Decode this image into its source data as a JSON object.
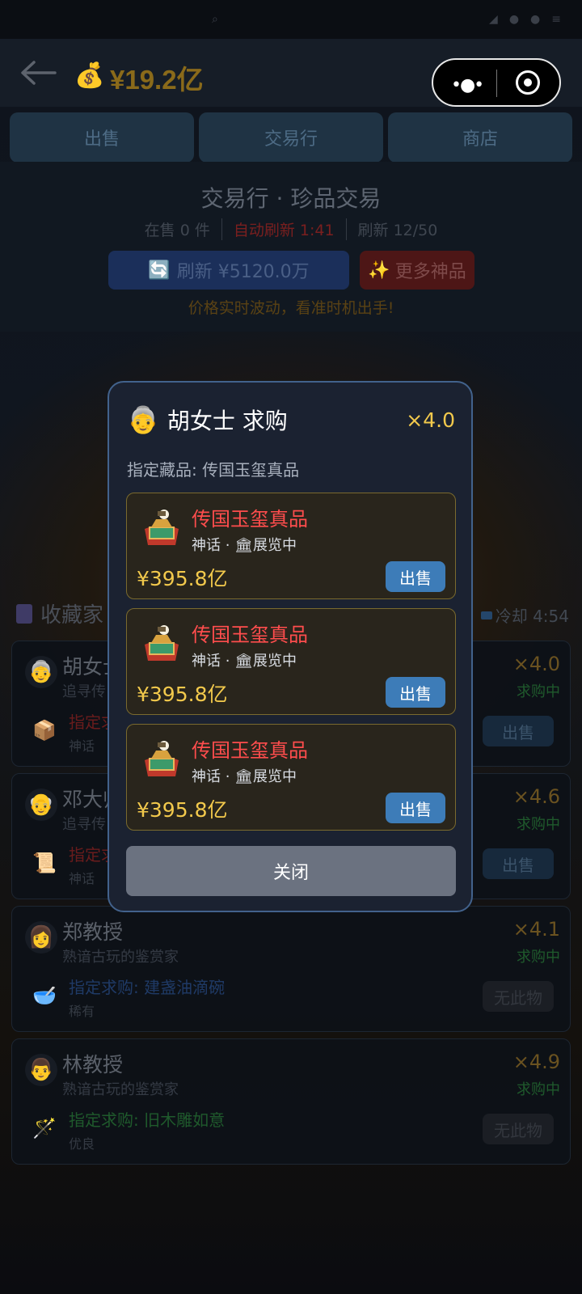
{
  "header": {
    "money": "¥19.2亿"
  },
  "tabs": [
    "出售",
    "交易行",
    "商店"
  ],
  "market": {
    "title": "交易行 · 珍品交易",
    "on_sale": "在售 0 件",
    "auto_refresh": "自动刷新 1:41",
    "refresh_count": "刷新 12/50",
    "refresh_label": "刷新 ¥5120.0万",
    "more_label": "更多神品",
    "hint": "价格实时波动，看准时机出手!"
  },
  "collectors": {
    "heading": "收藏家",
    "cooldown": "冷却 4:54",
    "cards": [
      {
        "name": "胡女士",
        "desc": "追寻传",
        "mult": "×4.0",
        "status": "求购中",
        "want": "指定求",
        "rarity": "神话",
        "button": "出售",
        "want_color": "#6a1c1c"
      },
      {
        "name": "邓大师",
        "desc": "追寻传",
        "mult": "×4.6",
        "status": "求购中",
        "want": "指定求",
        "rarity": "神话",
        "button": "出售",
        "want_color": "#6a1c1c"
      },
      {
        "name": "郑教授",
        "desc": "熟谙古玩的鉴赏家",
        "mult": "×4.1",
        "status": "求购中",
        "want": "指定求购: 建盏油滴碗",
        "rarity": "稀有",
        "button": "无此物",
        "want_color": "#1f3a66"
      },
      {
        "name": "林教授",
        "desc": "熟谙古玩的鉴赏家",
        "mult": "×4.9",
        "status": "求购中",
        "want": "指定求购: 旧木雕如意",
        "rarity": "优良",
        "button": "无此物",
        "want_color": "#1f5a2c"
      }
    ]
  },
  "modal": {
    "title": "胡女士 求购",
    "mult": "×4.0",
    "subtitle": "指定藏品: 传国玉玺真品",
    "offers": [
      {
        "name": "传国玉玺真品",
        "meta": "神话 · 🏛展览中",
        "price": "¥395.8亿",
        "button": "出售"
      },
      {
        "name": "传国玉玺真品",
        "meta": "神话 · 🏛展览中",
        "price": "¥395.8亿",
        "button": "出售"
      },
      {
        "name": "传国玉玺真品",
        "meta": "神话 · 🏛展览中",
        "price": "¥395.8亿",
        "button": "出售"
      }
    ],
    "close": "关闭"
  }
}
